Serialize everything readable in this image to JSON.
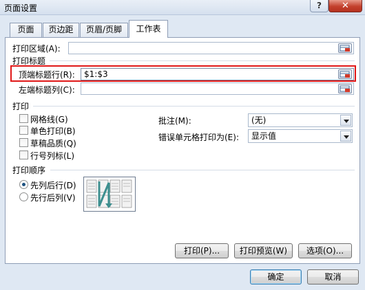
{
  "window": {
    "title": "页面设置",
    "help_label": "?",
    "close_label": "✕"
  },
  "tabs": [
    "页面",
    "页边距",
    "页眉/页脚",
    "工作表"
  ],
  "print_area": {
    "label": "打印区域(A):",
    "value": ""
  },
  "print_titles": {
    "section": "打印标题",
    "top_rows": {
      "label": "顶端标题行(R):",
      "value": "$1:$3"
    },
    "left_cols": {
      "label": "左端标题列(C):",
      "value": ""
    }
  },
  "print": {
    "section": "打印",
    "checkboxes": [
      "网格线(G)",
      "单色打印(B)",
      "草稿品质(Q)",
      "行号列标(L)"
    ],
    "comments": {
      "label": "批注(M):",
      "value": "(无)"
    },
    "errors": {
      "label": "错误单元格打印为(E):",
      "value": "显示值"
    }
  },
  "print_order": {
    "section": "打印顺序",
    "options": [
      "先列后行(D)",
      "先行后列(V)"
    ],
    "selected": 0
  },
  "buttons": {
    "print": "打印(P)...",
    "preview": "打印预览(W)",
    "options": "选项(O)...",
    "ok": "确定",
    "cancel": "取消"
  },
  "colors": {
    "highlight": "#e01818",
    "arrow": "#3d8f8f"
  }
}
